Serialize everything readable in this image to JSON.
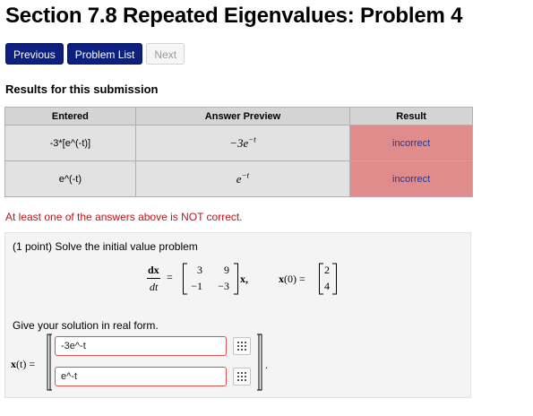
{
  "page": {
    "title": "Section 7.8 Repeated Eigenvalues: Problem 4"
  },
  "nav": {
    "previous": "Previous",
    "problem_list": "Problem List",
    "next": "Next"
  },
  "results": {
    "heading": "Results for this submission",
    "columns": [
      "Entered",
      "Answer Preview",
      "Result"
    ],
    "rows": [
      {
        "entered": "-3*[e^(-t)]",
        "preview_base": "−3e",
        "preview_exp": "−t",
        "result": "incorrect"
      },
      {
        "entered": "e^(-t)",
        "preview_base": "e",
        "preview_exp": "−t",
        "result": "incorrect"
      }
    ],
    "warning": "At least one of the answers above is NOT correct."
  },
  "problem": {
    "intro": "(1 point) Solve the initial value problem",
    "equation": {
      "lhs_num": "dx",
      "lhs_den": "dt",
      "matrix": [
        [
          "3",
          "9"
        ],
        [
          "−1",
          "−3"
        ]
      ],
      "rhs_var": "x,",
      "ic_label_bold": "x",
      "ic_label_rest": "(0) =",
      "ic_vector": [
        "2",
        "4"
      ]
    },
    "instruction": "Give your solution in real form.",
    "answer_label_bold": "x",
    "answer_label_rest": "(t) =",
    "answers": [
      "-3e^-t",
      "e^-t"
    ],
    "answer_end": "."
  },
  "colors": {
    "nav_primary": "#0d2080",
    "incorrect_bg": "#e08c8c",
    "warning": "#c0141a",
    "input_border": "#d9534f"
  }
}
